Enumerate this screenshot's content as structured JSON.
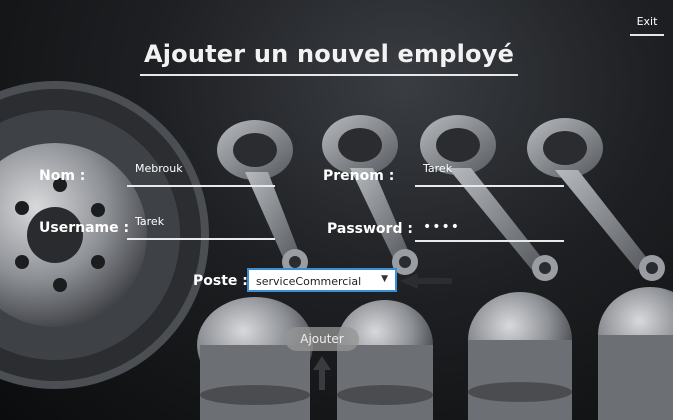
{
  "window": {
    "exit_label": "Exit"
  },
  "header": {
    "title": "Ajouter un nouvel employé"
  },
  "form": {
    "nom_label": "Nom :",
    "nom_value": "Mebrouk",
    "prenom_label": "Prenom :",
    "prenom_value": "Tarek",
    "username_label": "Username :",
    "username_value": "Tarek",
    "password_label": "Password :",
    "password_value": "••••",
    "poste_label": "Poste :",
    "poste_selected": "serviceCommercial",
    "submit_label": "Ajouter"
  },
  "colors": {
    "accent": "#3b8ed8",
    "text": "#ffffff"
  },
  "icons": {
    "dropdown": "chevron-down-icon",
    "hint_left": "arrow-left-icon",
    "hint_up": "arrow-up-icon"
  }
}
